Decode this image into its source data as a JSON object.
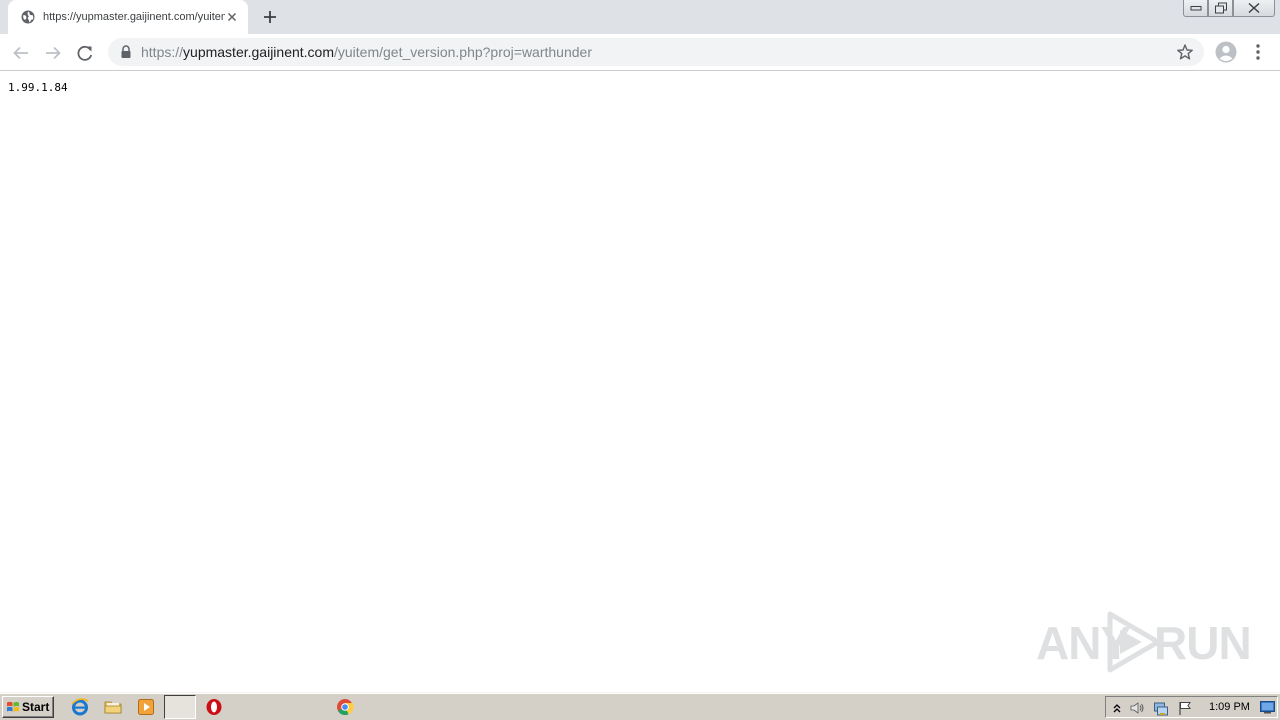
{
  "browser": {
    "tab": {
      "title": "https://yupmaster.gaijinent.com/yuitem/get_version.php?proj=warthunder",
      "favicon": "globe-icon"
    },
    "address_bar": {
      "scheme": "https://",
      "host": "yupmaster.gaijinent.com",
      "path": "/yuitem/get_version.php?proj=warthunder"
    }
  },
  "page": {
    "body_text": "1.99.1.84"
  },
  "watermark": {
    "left_text": "ANY",
    "right_text": "RUN"
  },
  "taskbar": {
    "start_label": "Start",
    "pinned": [
      "ie-icon",
      "folder-icon",
      "media-player-icon",
      "chrome-icon",
      "opera-icon"
    ],
    "clock": "1:09 PM"
  },
  "colors": {
    "tab_strip": "#dee1e6",
    "omnibox": "#f1f3f4",
    "taskbar": "#d4d0c8"
  }
}
